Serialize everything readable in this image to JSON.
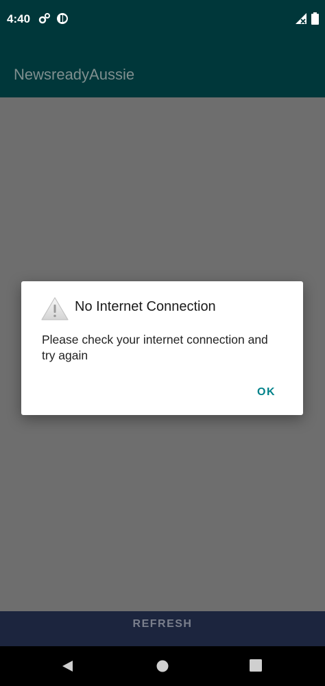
{
  "status_bar": {
    "time": "4:40",
    "icons": [
      "settings-icon",
      "info-circle-icon",
      "no-signal-icon",
      "battery-icon"
    ]
  },
  "app_bar": {
    "title": "NewsreadyAussie"
  },
  "dialog": {
    "title": "No Internet Connection",
    "message": "Please check your internet connection and try again",
    "ok_label": "OK",
    "icon": "warning-icon"
  },
  "refresh_bar": {
    "label": "REFRESH"
  },
  "nav_bar": {
    "buttons": [
      "back-icon",
      "home-icon",
      "recents-icon"
    ]
  },
  "colors": {
    "app_bar": "#00373a",
    "scrim_content": "#6e6e6e",
    "refresh_bar": "#1c253e",
    "accent": "#00828a"
  }
}
